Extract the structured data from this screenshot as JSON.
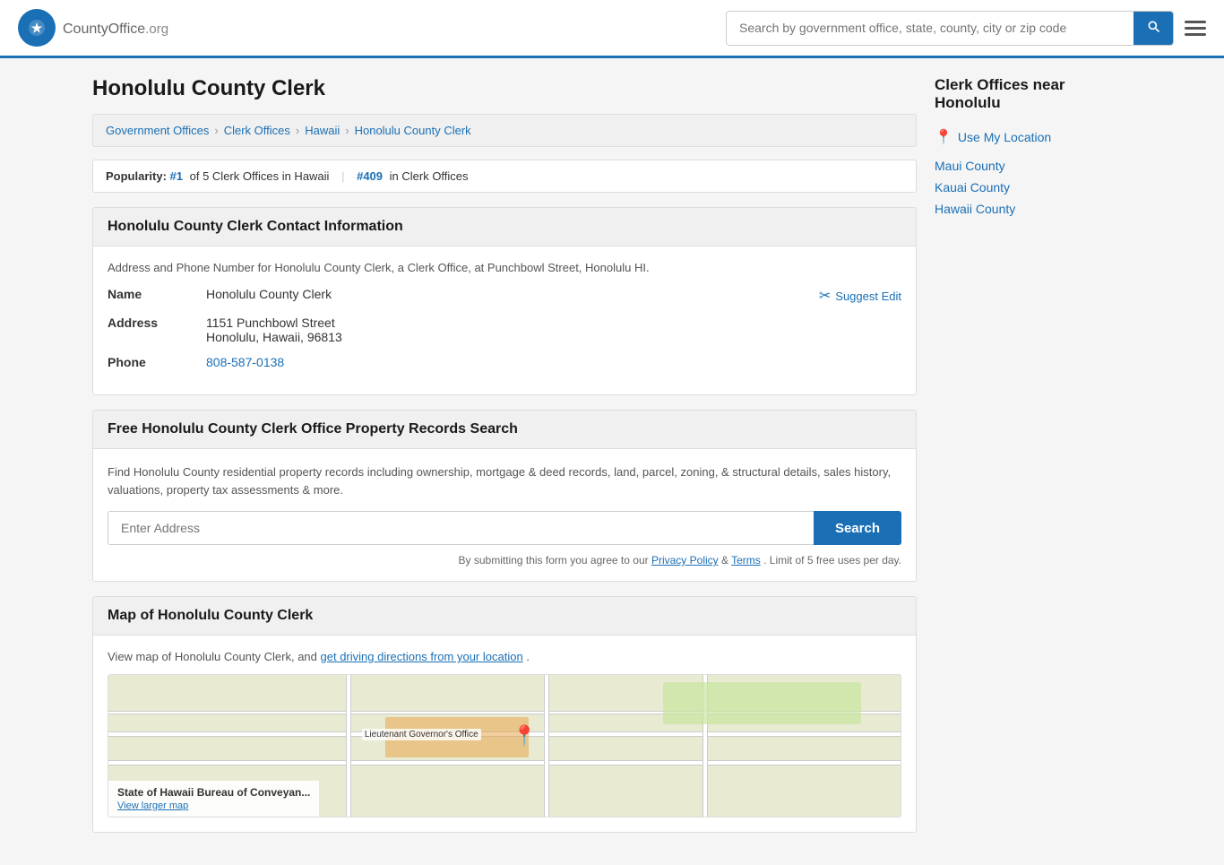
{
  "header": {
    "logo_text": "CountyOffice",
    "logo_suffix": ".org",
    "search_placeholder": "Search by government office, state, county, city or zip code"
  },
  "page": {
    "title": "Honolulu County Clerk",
    "breadcrumb": [
      {
        "label": "Government Offices",
        "href": "#"
      },
      {
        "label": "Clerk Offices",
        "href": "#"
      },
      {
        "label": "Hawaii",
        "href": "#"
      },
      {
        "label": "Honolulu County Clerk",
        "href": "#"
      }
    ]
  },
  "popularity": {
    "label": "Popularity:",
    "rank1": "#1",
    "rank1_text": "of 5 Clerk Offices in Hawaii",
    "rank2": "#409",
    "rank2_text": "in Clerk Offices"
  },
  "contact_section": {
    "title": "Honolulu County Clerk Contact Information",
    "description": "Address and Phone Number for Honolulu County Clerk, a Clerk Office, at Punchbowl Street, Honolulu HI.",
    "name_label": "Name",
    "name_value": "Honolulu County Clerk",
    "address_label": "Address",
    "address_line1": "1151 Punchbowl Street",
    "address_line2": "Honolulu, Hawaii, 96813",
    "phone_label": "Phone",
    "phone_value": "808-587-0138",
    "suggest_edit_label": "Suggest Edit"
  },
  "property_section": {
    "title": "Free Honolulu County Clerk Office Property Records Search",
    "description": "Find Honolulu County residential property records including ownership, mortgage & deed records, land, parcel, zoning, & structural details, sales history, valuations, property tax assessments & more.",
    "input_placeholder": "Enter Address",
    "search_button": "Search",
    "disclaimer": "By submitting this form you agree to our",
    "privacy_policy": "Privacy Policy",
    "terms": "Terms",
    "disclaimer_suffix": ". Limit of 5 free uses per day."
  },
  "map_section": {
    "title": "Map of Honolulu County Clerk",
    "description_prefix": "View map of Honolulu County Clerk, and",
    "directions_link": "get driving directions from your location",
    "description_suffix": ".",
    "overlay_business": "State of Hawaii Bureau of Conveyan...",
    "overlay_link": "View larger map",
    "map_label1": "Lieutenant Governor's Office",
    "pin_emoji": "📍"
  },
  "sidebar": {
    "title": "Clerk Offices near Honolulu",
    "use_my_location": "Use My Location",
    "nearby": [
      {
        "label": "Maui County",
        "href": "#"
      },
      {
        "label": "Kauai County",
        "href": "#"
      },
      {
        "label": "Hawaii County",
        "href": "#"
      }
    ]
  }
}
